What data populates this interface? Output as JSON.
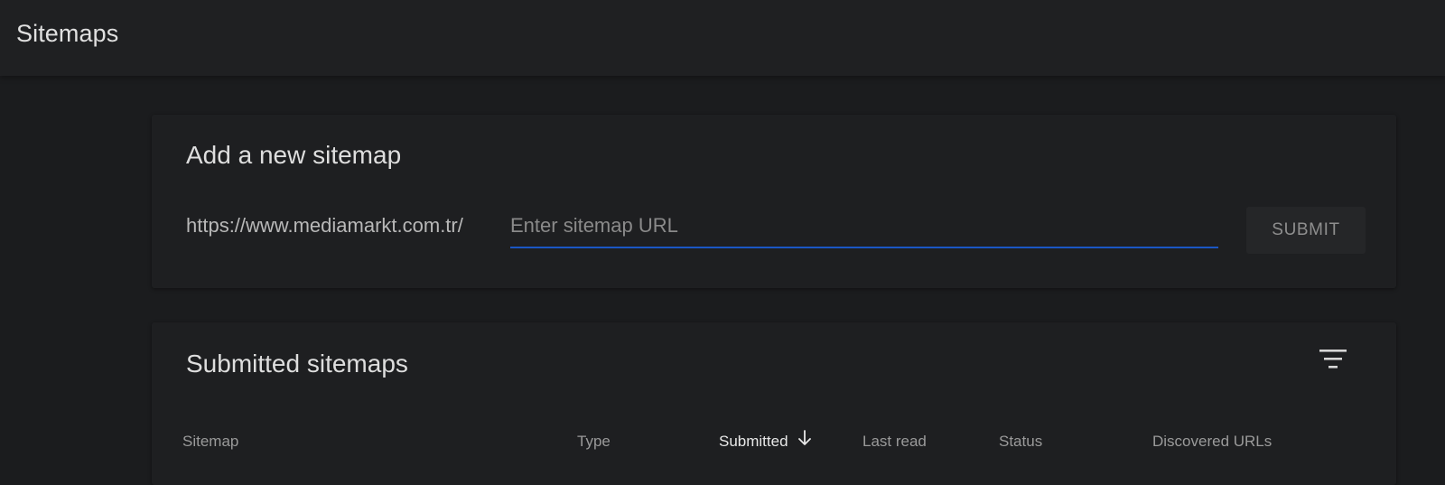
{
  "header": {
    "title": "Sitemaps"
  },
  "add_sitemap": {
    "title": "Add a new sitemap",
    "url_prefix": "https://www.mediamarkt.com.tr/",
    "input_value": "",
    "input_placeholder": "Enter sitemap URL",
    "submit_label": "SUBMIT"
  },
  "submitted_sitemaps": {
    "title": "Submitted sitemaps",
    "filter_icon": "filter-icon",
    "columns": [
      {
        "label": "Sitemap"
      },
      {
        "label": "Type"
      },
      {
        "label": "Submitted",
        "sorted": "descending"
      },
      {
        "label": "Last read"
      },
      {
        "label": "Status"
      },
      {
        "label": "Discovered URLs"
      }
    ]
  },
  "colors": {
    "background": "#1b1c1e",
    "card": "#1e1f21",
    "accent_underline": "#1a56c4"
  }
}
